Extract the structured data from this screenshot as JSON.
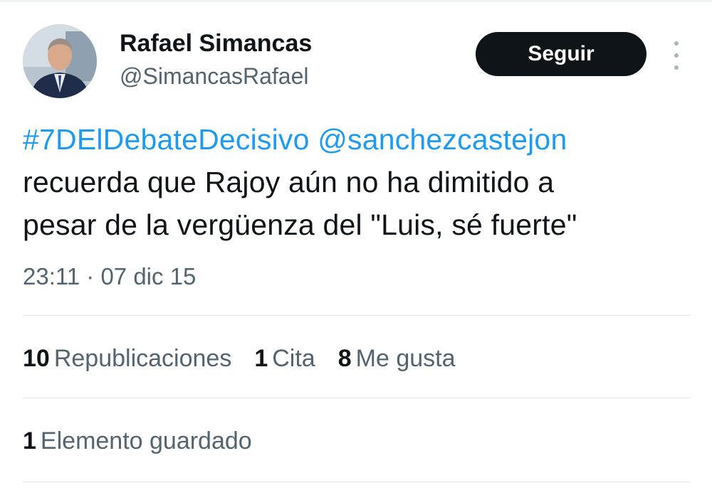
{
  "author": {
    "name": "Rafael Simancas",
    "handle": "@SimancasRafael"
  },
  "actions": {
    "follow_label": "Seguir",
    "more_icon": "more-vertical-icon"
  },
  "tweet": {
    "hashtag": "#7DElDebateDecisivo",
    "mention": "@sanchezcastejon",
    "line2": "recuerda que Rajoy aún no ha dimitido a",
    "line3": "pesar de la vergüenza del \"Luis, sé fuerte\"",
    "timestamp": "23:11 · 07 dic 15"
  },
  "stats": {
    "reposts_count": "10",
    "reposts_label": "Republicaciones",
    "quotes_count": "1",
    "quotes_label": "Cita",
    "likes_count": "8",
    "likes_label": "Me gusta",
    "bookmarks_count": "1",
    "bookmarks_label": "Elemento guardado"
  },
  "colors": {
    "link": "#1d9bf0",
    "text_primary": "#0f1419",
    "text_secondary": "#536471",
    "button_bg": "#0f1419"
  }
}
